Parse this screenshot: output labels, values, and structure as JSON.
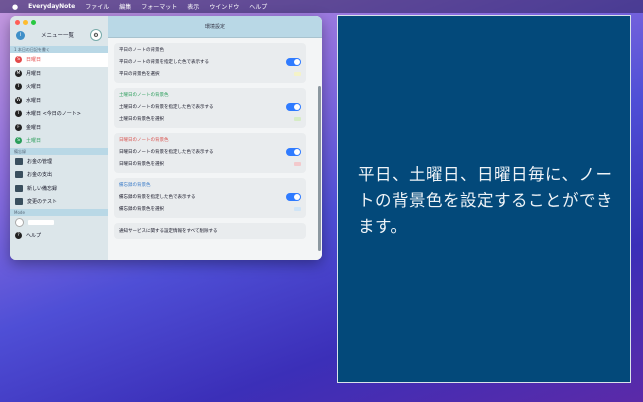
{
  "menubar": {
    "apple": "",
    "app_name": "EverydayNote",
    "items": [
      "ファイル",
      "編集",
      "フォーマット",
      "表示",
      "ウインドウ",
      "ヘルプ"
    ]
  },
  "sidebar": {
    "header_title": "メニュー一覧",
    "section1": "1 本日の日記を書く",
    "days": [
      {
        "label": "日曜日",
        "badge": "S",
        "color": "#e34a4a"
      },
      {
        "label": "月曜日",
        "badge": "M",
        "color": "#222222"
      },
      {
        "label": "火曜日",
        "badge": "T",
        "color": "#222222"
      },
      {
        "label": "水曜日",
        "badge": "W",
        "color": "#222222"
      },
      {
        "label": "木曜日 <今日のノート>",
        "badge": "T",
        "color": "#222222"
      },
      {
        "label": "金曜日",
        "badge": "F",
        "color": "#222222"
      },
      {
        "label": "土曜日",
        "badge": "S",
        "color": "#2a9d5a"
      }
    ],
    "section2": "備忘録",
    "memos": [
      "お金の管理",
      "お金の支出",
      "新しい備忘録",
      "変更のテスト"
    ],
    "section3": "Mode",
    "help": "ヘルプ"
  },
  "main": {
    "header": "環境設定",
    "groups": [
      {
        "title": "平日のノートの背景色",
        "title_color": "#223344",
        "row1": "平日のノートの背景を指定した色で表示する",
        "row2": "平日の背景色を選択",
        "swatch": "#f4f3c8"
      },
      {
        "title": "土曜日のノートの背景色",
        "title_color": "#2a9d5a",
        "row1": "土曜日のノートの背景を指定した色で表示する",
        "row2": "土曜日の背景色を選択",
        "swatch": "#d6ecc4"
      },
      {
        "title": "日曜日のノートの背景色",
        "title_color": "#d9534f",
        "row1": "日曜日のノートの背景を指定した色で表示する",
        "row2": "日曜日の背景色を選択",
        "swatch": "#f3c9cc"
      },
      {
        "title": "備忘録の背景色",
        "title_color": "#3a7bc8",
        "row1": "備忘録の背景を指定した色で表示する",
        "row2": "備忘録の背景色を選択",
        "swatch": "#cfe4f6"
      }
    ],
    "footer": "通知サービスに関する設定情報をすべて削除する"
  },
  "promo": {
    "text": "平日、土曜日、日曜日毎に、ノートの背景色を設定することができます。"
  }
}
